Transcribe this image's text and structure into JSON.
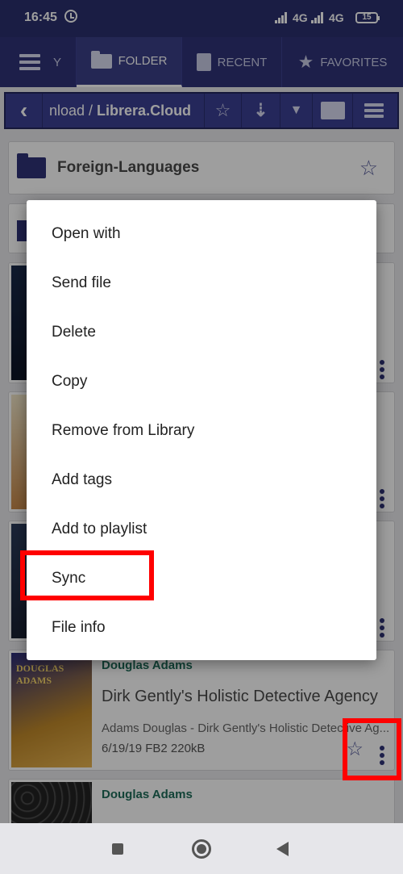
{
  "status_bar": {
    "time": "16:45",
    "network_1": "4G",
    "network_2": "4G",
    "battery": "15"
  },
  "tabs": [
    {
      "label": "Y",
      "icon": "menu-icon"
    },
    {
      "label": "FOLDER",
      "icon": "folder-icon"
    },
    {
      "label": "RECENT",
      "icon": "book-icon"
    },
    {
      "label": "FAVORITES",
      "icon": "star-icon"
    }
  ],
  "path_bar": {
    "path_prefix": "nload / ",
    "path_current": "Librera.Cloud"
  },
  "folders": [
    {
      "name": "Foreign-Languages"
    }
  ],
  "books": [
    {
      "author": "Douglas Adams",
      "title": "Dirk Gently's Holistic Detective Agency",
      "description": "Adams Douglas - Dirk Gently's Holistic Detective Ag...",
      "meta": "6/19/19  FB2  220kB",
      "cover_text": "DOUGLAS ADAMS"
    },
    {
      "author": "Douglas Adams"
    }
  ],
  "context_menu": {
    "items": [
      "Open with",
      "Send file",
      "Delete",
      "Copy",
      "Remove from Library",
      "Add tags",
      "Add to playlist",
      "Sync",
      "File info"
    ]
  },
  "colors": {
    "primary": "#2f3378",
    "highlight": "#ff0000",
    "author_green": "#1e6d5a"
  }
}
